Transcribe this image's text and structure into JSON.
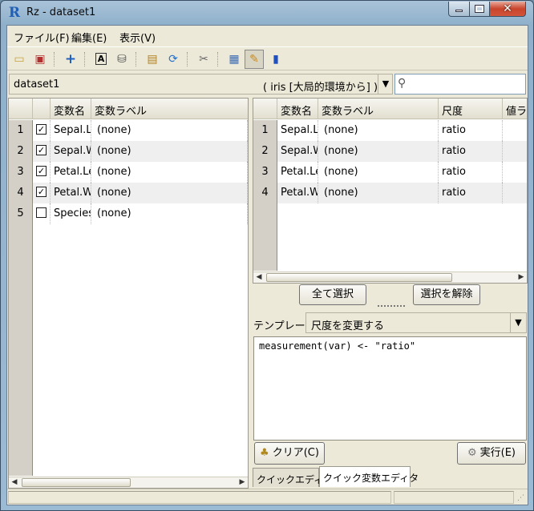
{
  "window": {
    "title": "Rz - dataset1",
    "app_icon_letter": "R"
  },
  "menu": {
    "items": [
      "ファイル(F)",
      "編集(E)",
      "表示(V)"
    ]
  },
  "toolbar": {
    "icons": [
      "open-folder-icon",
      "save-icon",
      "add-icon",
      "text-label-icon",
      "database-icon",
      "import-icon",
      "refresh-icon",
      "tools-icon",
      "grid-view-icon",
      "edit-view-icon",
      "chart-icon"
    ]
  },
  "dataset": {
    "name": "dataset1",
    "env": "( iris [大局的環境から] )",
    "search_placeholder": ""
  },
  "left_table": {
    "headers": [
      "",
      "",
      "変数名",
      "変数ラベル"
    ],
    "rows": [
      {
        "num": "1",
        "checked": true,
        "name": "Sepal.Length",
        "label": "(none)"
      },
      {
        "num": "2",
        "checked": true,
        "name": "Sepal.Width",
        "label": "(none)"
      },
      {
        "num": "3",
        "checked": true,
        "name": "Petal.Length",
        "label": "(none)"
      },
      {
        "num": "4",
        "checked": true,
        "name": "Petal.Width",
        "label": "(none)"
      },
      {
        "num": "5",
        "checked": false,
        "name": "Species",
        "label": "(none)"
      }
    ]
  },
  "right_table": {
    "headers": [
      "",
      "変数名",
      "変数ラベル",
      "尺度",
      "値ラベル"
    ],
    "rows": [
      {
        "num": "1",
        "name": "Sepal.Length",
        "label": "(none)",
        "scale": "ratio"
      },
      {
        "num": "2",
        "name": "Sepal.Width",
        "label": "(none)",
        "scale": "ratio"
      },
      {
        "num": "3",
        "name": "Petal.Length",
        "label": "(none)",
        "scale": "ratio"
      },
      {
        "num": "4",
        "name": "Petal.Width",
        "label": "(none)",
        "scale": "ratio"
      }
    ]
  },
  "buttons": {
    "select_all": "全て選択",
    "deselect": "選択を解除",
    "clear": "クリア(C)",
    "run": "実行(E)"
  },
  "template": {
    "label": "テンプレート",
    "selected": "尺度を変更する"
  },
  "code": "measurement(var) <- \"ratio\"",
  "tabs": [
    "クイックエディタ",
    "クイック変数エディタ"
  ]
}
